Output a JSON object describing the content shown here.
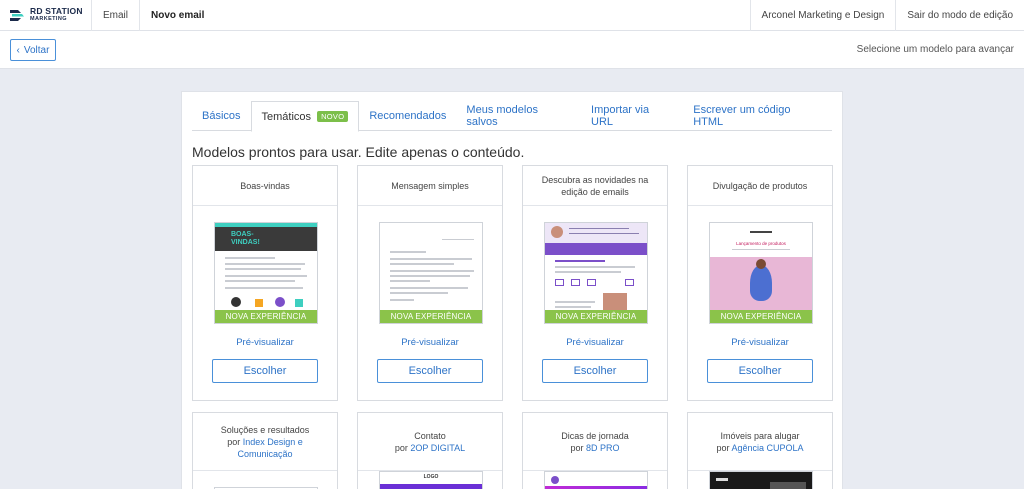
{
  "nav": {
    "logo_line1": "RD STATION",
    "logo_line2": "MARKETING",
    "email": "Email",
    "current": "Novo email",
    "account": "Arconel Marketing e Design",
    "exit": "Sair do modo de edição"
  },
  "subbar": {
    "back_label": "Voltar",
    "hint": "Selecione um modelo para avançar"
  },
  "tabs": [
    {
      "label": "Básicos"
    },
    {
      "label": "Temáticos",
      "badge": "NOVO"
    },
    {
      "label": "Recomendados"
    },
    {
      "label": "Meus modelos salvos"
    },
    {
      "label": "Importar via URL"
    },
    {
      "label": "Escrever um código HTML"
    }
  ],
  "heading": "Modelos prontos para usar. Edite apenas o conteúdo.",
  "cards": [
    {
      "title": "Boas-vindas",
      "banner": "NOVA EXPERIÊNCIA",
      "preview": "Pré-visualizar",
      "choose": "Escolher",
      "thumb_text": "BOAS-VINDAS!"
    },
    {
      "title": "Mensagem simples",
      "banner": "NOVA EXPERIÊNCIA",
      "preview": "Pré-visualizar",
      "choose": "Escolher"
    },
    {
      "title": "Descubra as novidades na edição de emails",
      "banner": "NOVA EXPERIÊNCIA",
      "preview": "Pré-visualizar",
      "choose": "Escolher"
    },
    {
      "title": "Divulgação de produtos",
      "banner": "NOVA EXPERIÊNCIA",
      "preview": "Pré-visualizar",
      "choose": "Escolher",
      "thumb_text": "Lançamento de produtos"
    }
  ],
  "cards_row2": [
    {
      "title": "Soluções e resultados",
      "by": "por",
      "author": "Index Design e Comunicação"
    },
    {
      "title": "Contato",
      "by": "por",
      "author": "2OP DIGITAL",
      "thumb_text": "LOGO"
    },
    {
      "title": "Dicas de jornada",
      "by": "por",
      "author": "8D PRO"
    },
    {
      "title": "Imóveis para alugar",
      "by": "por",
      "author": "Agência CUPOLA"
    }
  ],
  "colors": {
    "accent": "#2d73c7",
    "badge": "#7cbf4a",
    "banner": "#8bc34a",
    "welcome_teal": "#3ecfc0",
    "purple": "#7b4fc9"
  }
}
